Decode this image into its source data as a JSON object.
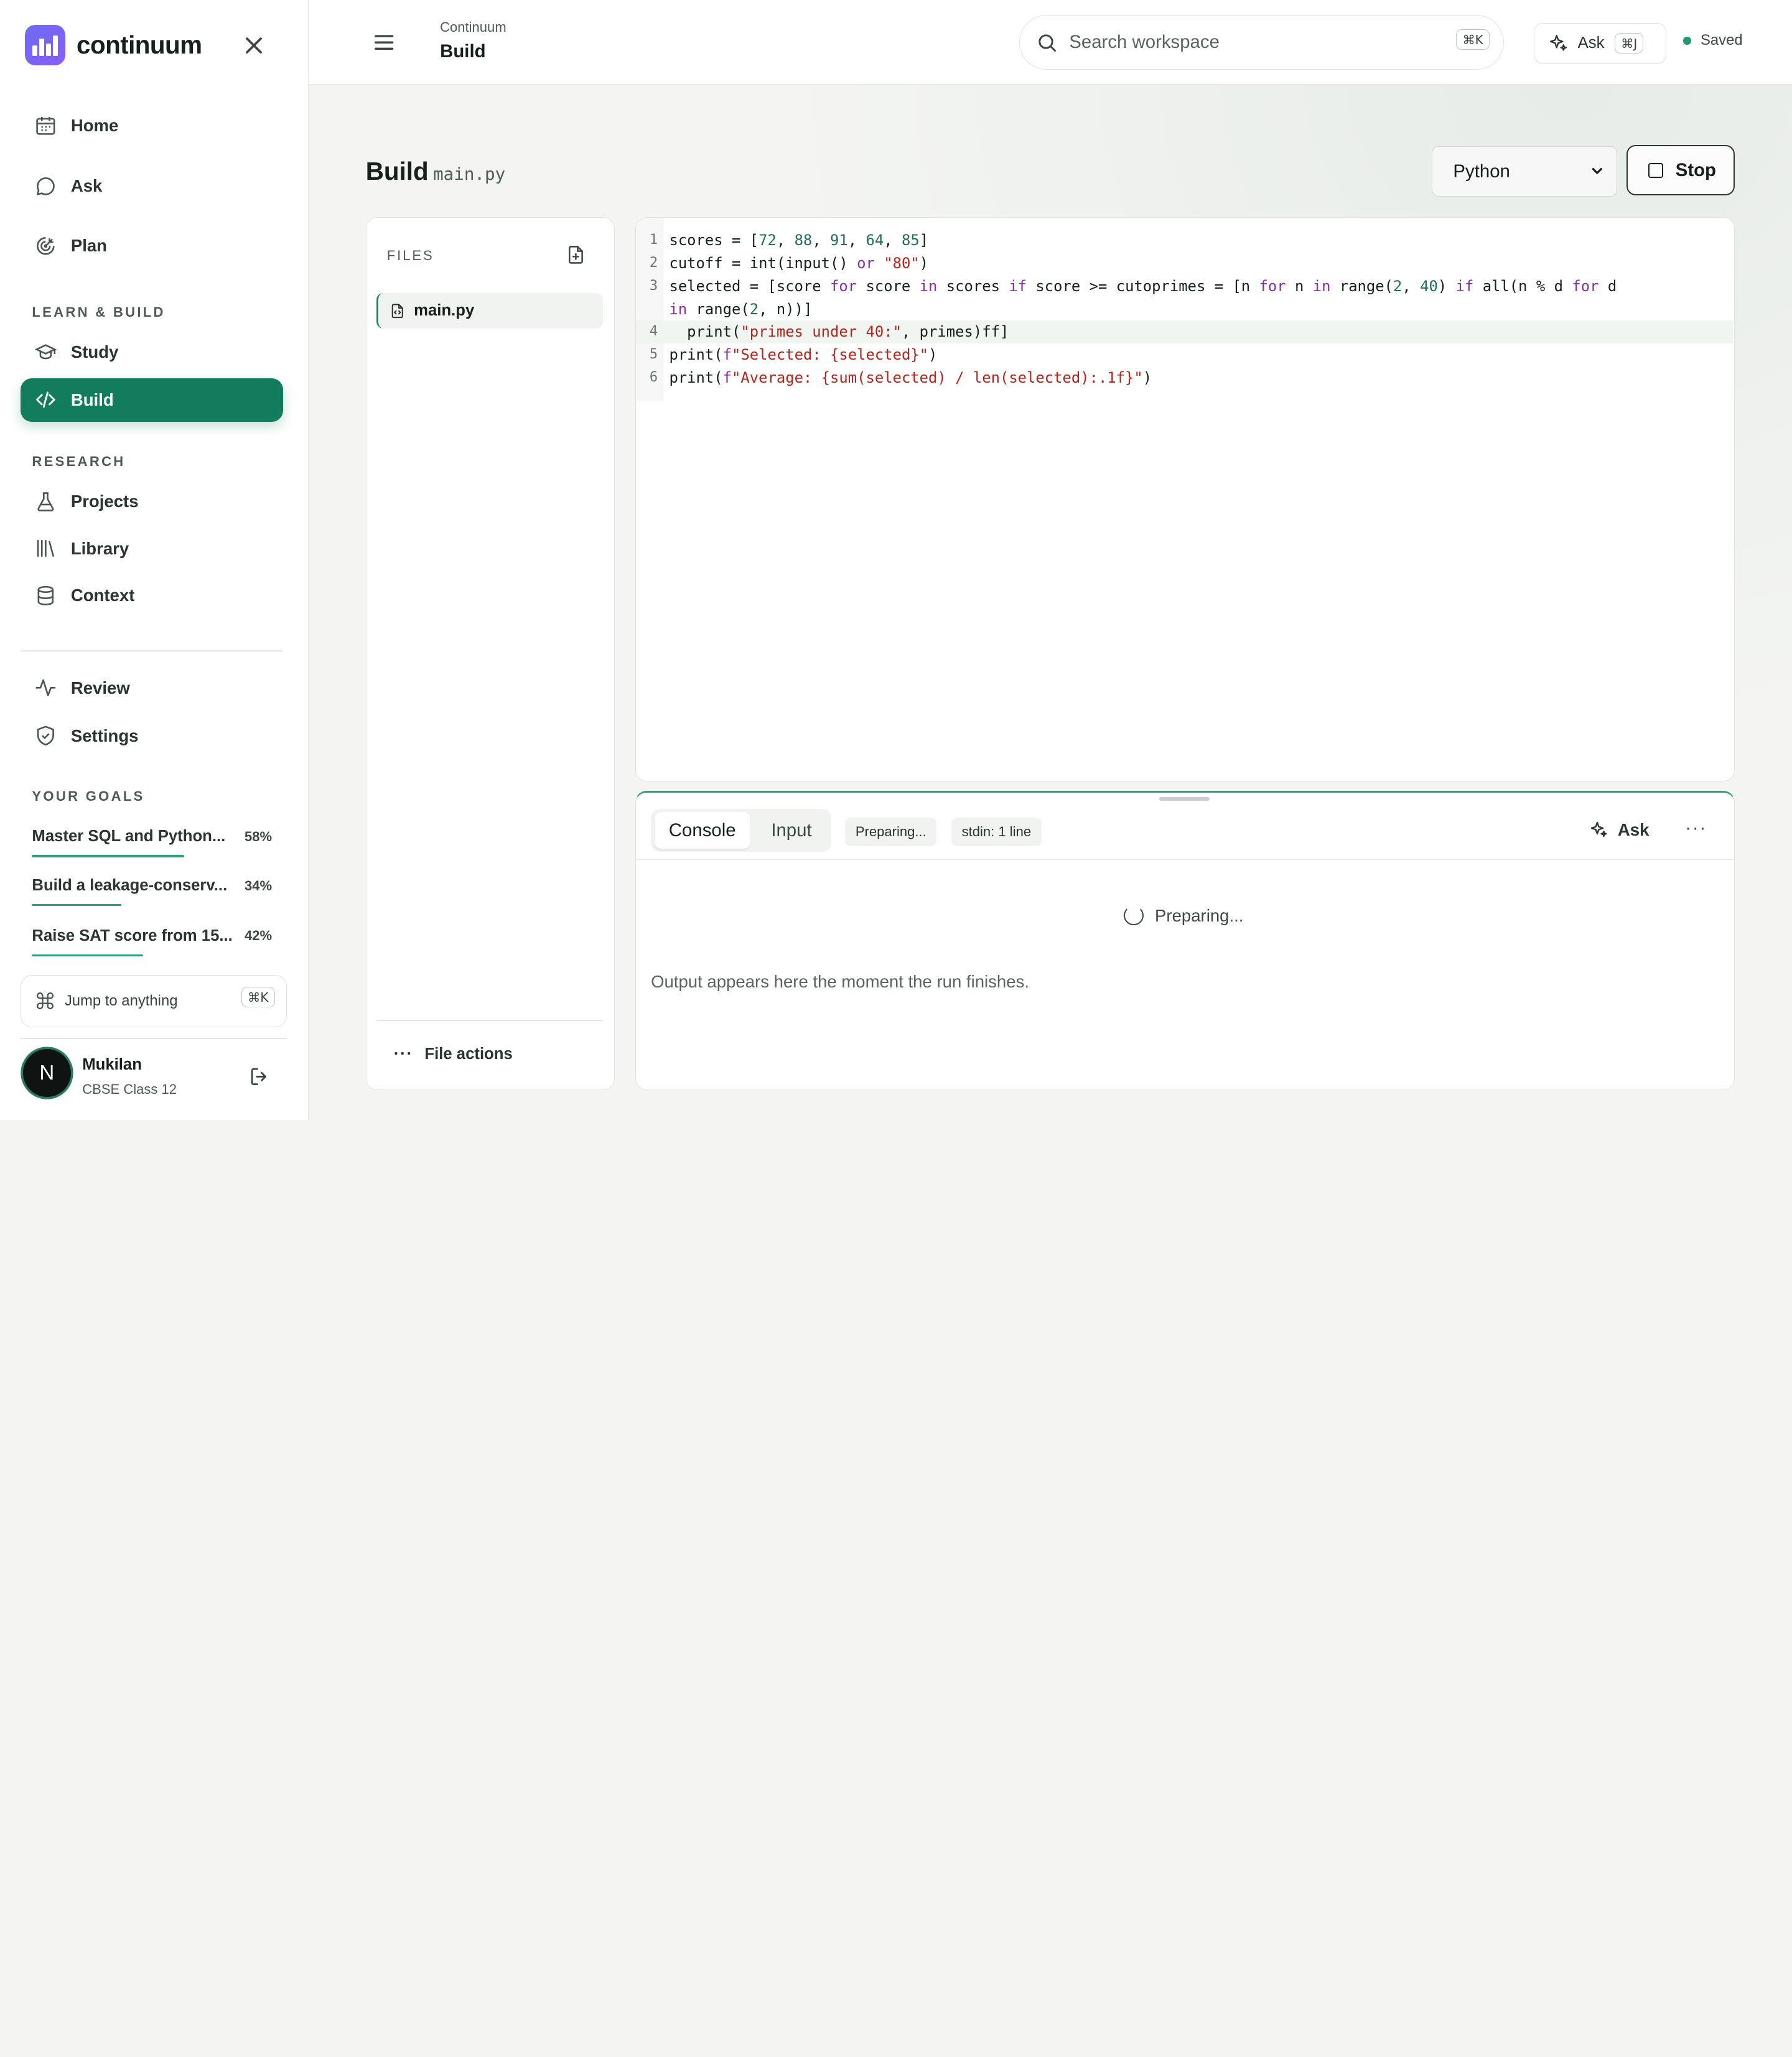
{
  "app": {
    "name": "continuum",
    "brand_color": "#6c6cf0",
    "accent_color": "#137c5c"
  },
  "sidebar": {
    "nav_primary": [
      {
        "label": "Home",
        "icon": "calendar-icon"
      },
      {
        "label": "Ask",
        "icon": "chat-bubble-icon"
      },
      {
        "label": "Plan",
        "icon": "target-icon"
      }
    ],
    "section_learn": "LEARN & BUILD",
    "nav_learn": [
      {
        "label": "Study",
        "icon": "graduation-cap-icon"
      },
      {
        "label": "Build",
        "icon": "code-icon",
        "active": true
      }
    ],
    "section_research": "RESEARCH",
    "nav_research": [
      {
        "label": "Projects",
        "icon": "flask-icon"
      },
      {
        "label": "Library",
        "icon": "library-icon"
      },
      {
        "label": "Context",
        "icon": "database-icon"
      }
    ],
    "nav_secondary": [
      {
        "label": "Review",
        "icon": "activity-icon"
      },
      {
        "label": "Settings",
        "icon": "shield-icon"
      }
    ],
    "section_goals": "YOUR GOALS",
    "goals": [
      {
        "title": "Master SQL and Python...",
        "percent_label": "58%",
        "progress": 0.58
      },
      {
        "title": "Build a leakage-conserv...",
        "percent_label": "34%",
        "progress": 0.34
      },
      {
        "title": "Raise SAT score from 15...",
        "percent_label": "42%",
        "progress": 0.42
      }
    ],
    "jump": {
      "label": "Jump to anything",
      "shortcut": "⌘K"
    },
    "user": {
      "initial": "N",
      "name": "Mukilan",
      "subtitle": "CBSE Class 12"
    }
  },
  "topbar": {
    "breadcrumb_parent": "Continuum",
    "breadcrumb_current": "Build",
    "search_placeholder": "Search workspace",
    "search_shortcut": "⌘K",
    "ask_label": "Ask",
    "ask_shortcut": "⌘J",
    "status": "Saved",
    "status_color": "#1f9a70"
  },
  "main": {
    "title": "Build",
    "filename": "main.py",
    "language": "Python",
    "stop_label": "Stop"
  },
  "files": {
    "label": "FILES",
    "items": [
      {
        "name": "main.py"
      }
    ],
    "actions_label": "File actions"
  },
  "editor": {
    "lines": [
      {
        "n": "1",
        "text": "scores = [72, 88, 91, 64, 85]"
      },
      {
        "n": "2",
        "text": "cutoff = int(input() or \"80\")"
      },
      {
        "n": "3",
        "text": "selected = [score for score in scores if score >= cutoprimes = [n for n in range(2, 40) if all(n % d for d"
      },
      {
        "n": "",
        "text": "in range(2, n))]"
      },
      {
        "n": "4",
        "text": "  print(\"primes under 40:\", primes)ff]"
      },
      {
        "n": "5",
        "text": "print(f\"Selected: {selected}\")"
      },
      {
        "n": "6",
        "text": "print(f\"Average: {sum(selected) / len(selected):.1f}\")"
      }
    ],
    "highlighted_line": "4"
  },
  "console": {
    "tabs": [
      "Console",
      "Input"
    ],
    "active_tab": "Console",
    "chip_status": "Preparing...",
    "chip_stdin": "stdin: 1 line",
    "ask_label": "Ask",
    "more_label": "···",
    "status_text": "Preparing...",
    "hint": "Output appears here the moment the run finishes."
  }
}
